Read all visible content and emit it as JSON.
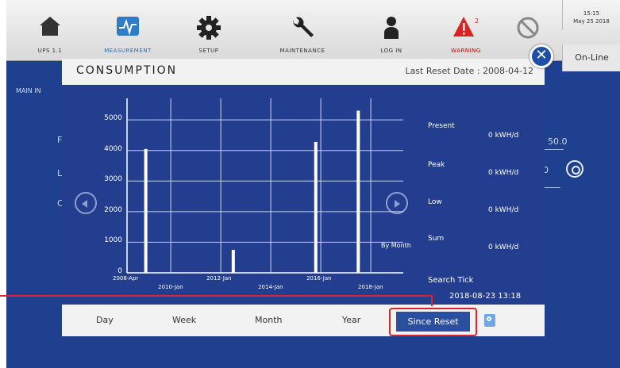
{
  "toolbar": {
    "items": [
      {
        "label": "UPS 1.1",
        "icon": "home-icon"
      },
      {
        "label": "MEASUREMENT",
        "icon": "measurement-icon"
      },
      {
        "label": "SETUP",
        "icon": "gear-icon"
      },
      {
        "label": "MAINTENANCE",
        "icon": "wrench-icon"
      },
      {
        "label": "LOG IN",
        "icon": "user-icon"
      },
      {
        "label": "WARNING",
        "icon": "warning-icon",
        "badge": "2"
      },
      {
        "label": "",
        "icon": "mute-icon"
      }
    ],
    "time": "15:15",
    "date": "May 25 2018",
    "status": "On-Line"
  },
  "background": {
    "section": "MAIN IN",
    "fragments": [
      "F",
      "L",
      "C",
      "50.0",
      "0"
    ]
  },
  "dialog": {
    "title": "CONSUMPTION",
    "last_reset": "Last Reset Date : 2008-04-12",
    "close_glyph": "✕",
    "by_month": "By Month",
    "stats": [
      {
        "label": "Present",
        "value": "0  kWH/d"
      },
      {
        "label": "Peak",
        "value": "0  kWH/d"
      },
      {
        "label": "Low",
        "value": "0  kWH/d"
      },
      {
        "label": "Sum",
        "value": "0  kWH/d"
      }
    ],
    "search_tick_label": "Search Tick",
    "search_tick_value": "2018-08-23  13:18",
    "tabs": [
      "Day",
      "Week",
      "Month",
      "Year",
      "Since Reset"
    ]
  },
  "chart_data": {
    "type": "bar",
    "yticks": [
      "0",
      "1000",
      "2000",
      "3000",
      "4000",
      "5000"
    ],
    "ylim": [
      0,
      5600
    ],
    "xticks_upper": [
      "2008-Apr",
      "2012-Jan",
      "2016-Jan"
    ],
    "xticks_lower": [
      "2010-Jan",
      "2014-Jan",
      "2018-Jan"
    ],
    "xlim": [
      2008.25,
      2019.3
    ],
    "bars": [
      {
        "x": 2009.0,
        "value": 4050
      },
      {
        "x": 2012.5,
        "value": 750
      },
      {
        "x": 2015.8,
        "value": 4280
      },
      {
        "x": 2017.5,
        "value": 5300
      }
    ],
    "grid": true
  },
  "colors": {
    "panel_bg": "#233e8f",
    "bar": "#ffffff",
    "grid": "#c9d3ee",
    "highlight": "#d8262b",
    "tab_active": "#2a4f9e"
  }
}
